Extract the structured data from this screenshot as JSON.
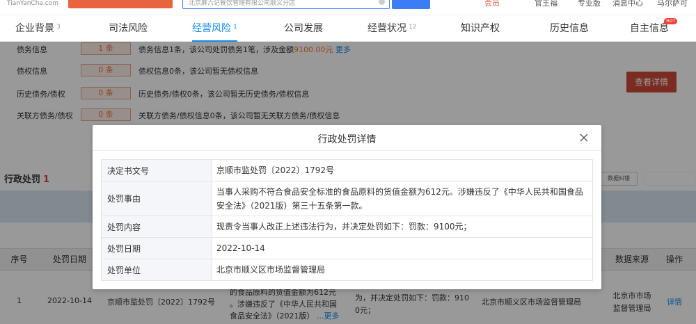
{
  "topbar": {
    "logo_text": "TianYanCha.com",
    "search_value": "北京麻六记餐饮管理有限公司顺义分店",
    "links": [
      "会员",
      "官王福",
      "专业版",
      "消息中心",
      "马尔萨可"
    ]
  },
  "nav": {
    "tabs": [
      {
        "label": "企业背景",
        "count": "3"
      },
      {
        "label": "司法风险",
        "count": ""
      },
      {
        "label": "经营风险",
        "count": "1"
      },
      {
        "label": "公司发展",
        "count": ""
      },
      {
        "label": "经营状况",
        "count": "12"
      },
      {
        "label": "知识产权",
        "count": ""
      },
      {
        "label": "历史信息",
        "count": ""
      },
      {
        "label": "自主信息",
        "count": ""
      }
    ],
    "active_index": 2,
    "hot_badge": "HOT"
  },
  "debt": {
    "rows": [
      {
        "label": "债务信息",
        "count": "1 条",
        "desc_pre": "债务信息1条，该公司处罚债务1笔，涉及金额",
        "amount": "9100.00元",
        "more": "更多"
      },
      {
        "label": "债权信息",
        "count": "0 条",
        "desc_pre": "债权信息0条，该公司暂无债权信息",
        "amount": "",
        "more": ""
      },
      {
        "label": "历史债务/债权",
        "count": "0 条",
        "desc_pre": "历史债务/债权0条，该公司暂无历史债务/债权信息",
        "amount": "",
        "more": ""
      },
      {
        "label": "关联方债务/债权",
        "count": "0 条",
        "desc_pre": "关联方债务/债权信息0条，该公司暂无关联方债务/债权信息",
        "amount": "",
        "more": ""
      }
    ],
    "view_detail": "查看详情"
  },
  "section": {
    "title": "行政处罚",
    "count": "1",
    "correct_btn": "数据纠错"
  },
  "table": {
    "headers": [
      "序号",
      "处罚日期",
      "数据来源",
      "操作"
    ],
    "row": {
      "index": "1",
      "date": "2022-10-14",
      "doc_no": "京顺市监处罚〔2022〕1792号",
      "reason_lines": [
        "的食品原料的货值金额为612元",
        "。涉嫌违反了《中华人民共和国",
        "食品安全法》（2021版）"
      ],
      "reason_more": "...更多",
      "content_lines": [
        "为，并决定处罚如下：罚款：910",
        "0元；"
      ],
      "unit": "北京市顺义区市场监督管理局",
      "source_lines": [
        "北京市市场",
        "监督管理局"
      ],
      "action": "详情"
    }
  },
  "modal": {
    "title": "行政处罚详情",
    "rows": [
      {
        "key": "决定书文号",
        "value": "京顺市监处罚〔2022〕1792号"
      },
      {
        "key": "处罚事由",
        "value": "当事人采购不符合食品安全标准的食品原料的货值金额为612元。涉嫌违反了《中华人民共和国食品安全法》（2021版）第三十五条第一款。"
      },
      {
        "key": "处罚内容",
        "value": "现责令当事人改正上述违法行为，并决定处罚如下：罚款：9100元；"
      },
      {
        "key": "处罚日期",
        "value": "2022-10-14"
      },
      {
        "key": "处罚单位",
        "value": "北京市顺义区市场监督管理局"
      }
    ]
  },
  "colors": {
    "accent": "#128bed",
    "danger": "#cd4a38",
    "orange": "#f0742f"
  }
}
